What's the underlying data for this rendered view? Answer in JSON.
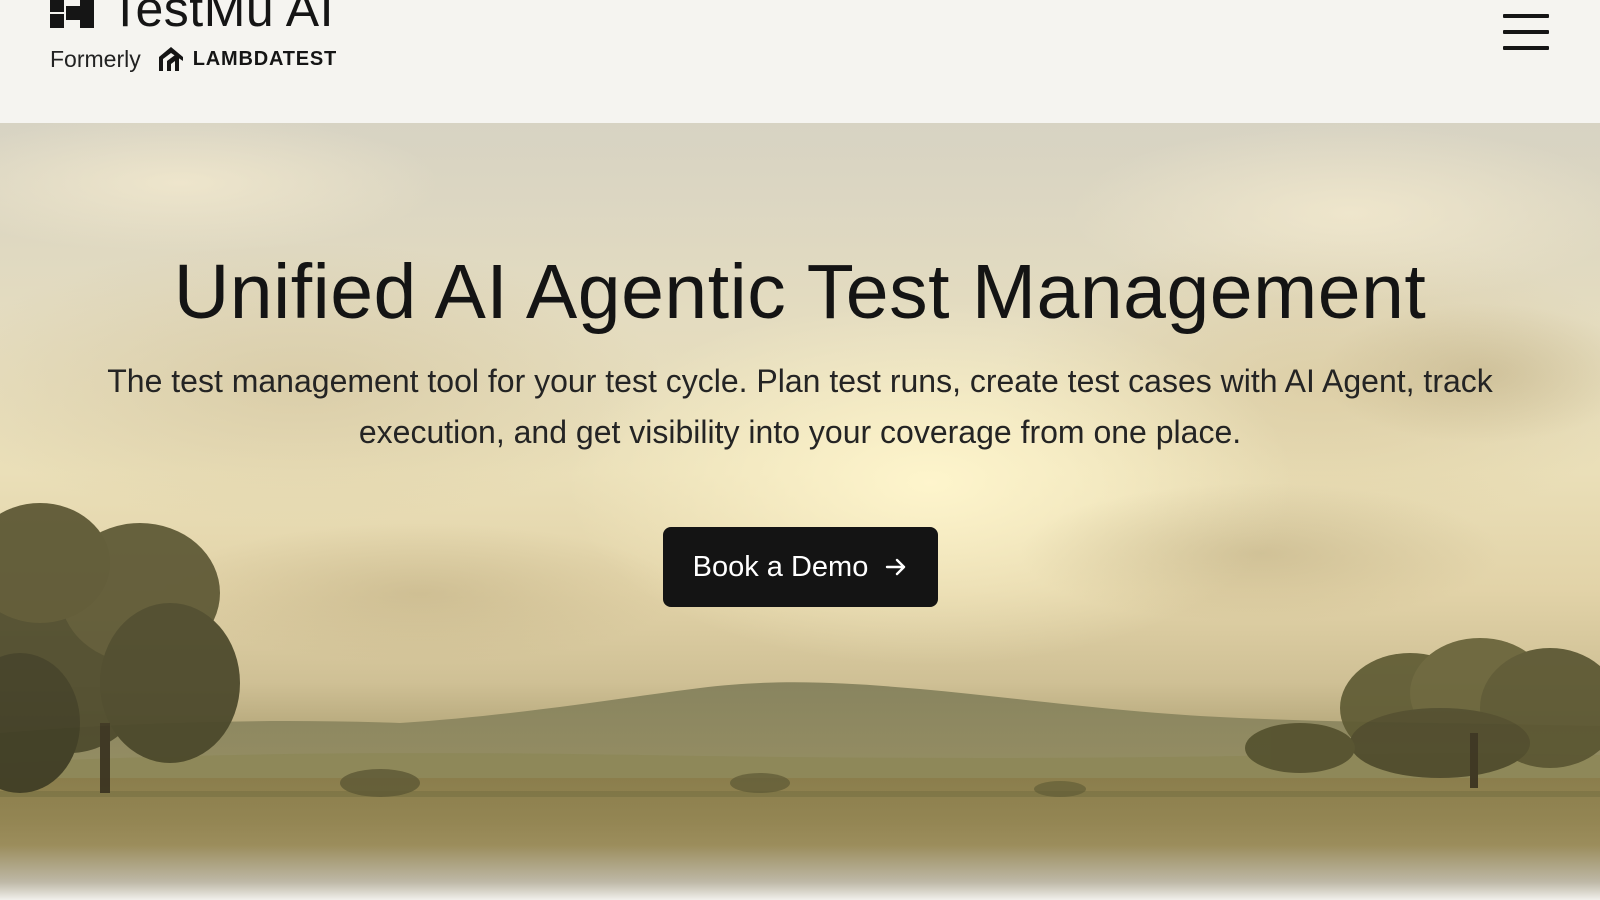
{
  "header": {
    "logo_name": "TestMu AI",
    "formerly_label": "Formerly",
    "former_brand": "LAMBDATEST",
    "menu_icon": "hamburger-menu-icon"
  },
  "hero": {
    "title": "Unified AI Agentic Test Management",
    "subtitle": "The test management tool for your test cycle. Plan test runs, create test cases with AI Agent, track execution, and get visibility into your coverage from one place.",
    "cta_label": "Book a Demo",
    "cta_icon": "arrow-right-icon",
    "background_image": "landscape-painting"
  },
  "colors": {
    "header_bg": "#f5f4f0",
    "text_dark": "#141414",
    "button_bg": "#141414",
    "button_text": "#ffffff"
  }
}
